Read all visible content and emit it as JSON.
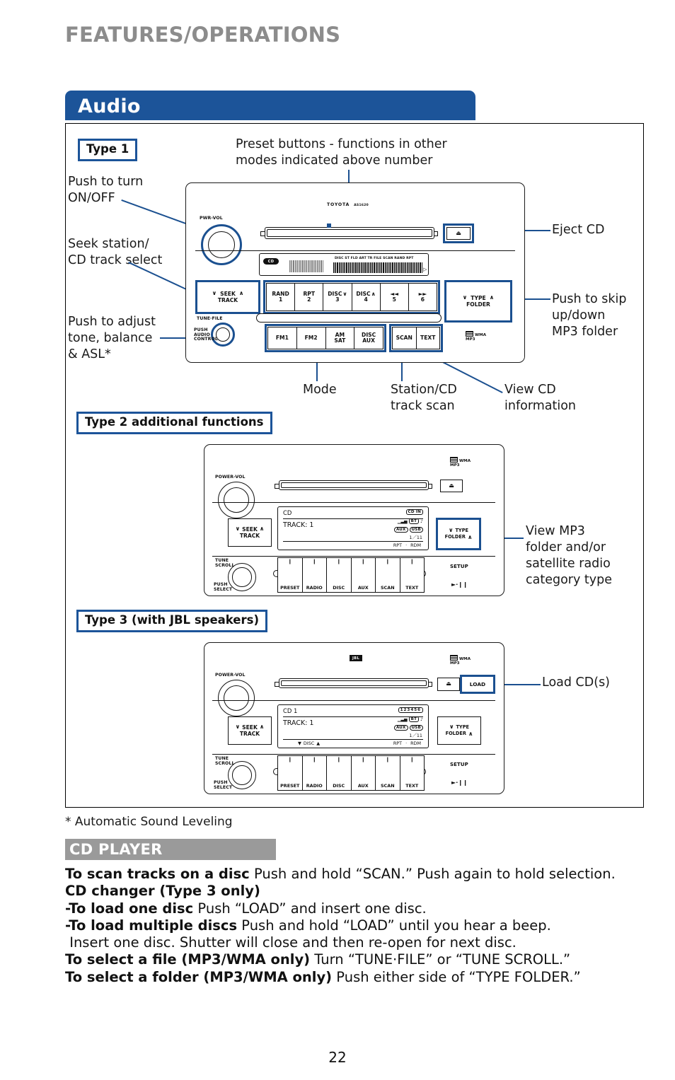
{
  "header": {
    "title": "FEATURES/OPERATIONS"
  },
  "section": {
    "audio_title": "Audio"
  },
  "badges": {
    "type1": "Type 1",
    "type2": "Type 2 additional functions",
    "type3": "Type 3 (with JBL speakers)"
  },
  "callouts": {
    "preset_buttons": "Preset buttons - functions in other\nmodes indicated above number",
    "power_onoff": "Push to turn\nON/OFF",
    "seek_station": "Seek station/\nCD track select",
    "tone_balance": "Push to adjust\ntone, balance\n& ASL*",
    "eject_cd": "Eject CD",
    "skip_folder": "Push to skip\nup/down\nMP3 folder",
    "mode": "Mode",
    "station_scan": "Station/CD\ntrack scan",
    "view_cd_info": "View CD\ninformation",
    "view_mp3_folder": "View MP3\nfolder and/or\nsatellite radio\ncategory type",
    "load_cds": "Load CD(s)"
  },
  "type1_unit": {
    "brand": "TOYOTA",
    "model": "AS1620",
    "pwr_vol_label": "PWR-VOL",
    "tune_file_label": "TUNE·FILE",
    "push_audio_control": "PUSH\nAUDIO\nCONTROL",
    "seek_label_top": "SEEK",
    "seek_label_bottom": "TRACK",
    "type_folder_top": "TYPE",
    "type_folder_bottom": "FOLDER",
    "eject_icon": "eject-icon",
    "wma_mp3": "WMA\nMP3",
    "lcd_indicators": "DISC  ST  FLD  ART  TR  FILE  SCAN  RAND  RPT",
    "lcd_cd_tag": "CD",
    "preset_buttons": [
      {
        "top": "RAND",
        "num": "1"
      },
      {
        "top": "RPT",
        "num": "2"
      },
      {
        "top": "DISC",
        "num": "3",
        "chev": "down"
      },
      {
        "top": "DISC",
        "num": "4",
        "chev": "up"
      },
      {
        "top": "◄◄",
        "num": "5"
      },
      {
        "top": "►►",
        "num": "6"
      }
    ],
    "mode_buttons": [
      {
        "line1": "FM1",
        "line2": ""
      },
      {
        "line1": "FM2",
        "line2": ""
      },
      {
        "line1": "AM",
        "line2": "SAT"
      },
      {
        "line1": "DISC",
        "line2": "AUX"
      }
    ],
    "scan_text_buttons": [
      "SCAN",
      "TEXT"
    ]
  },
  "type2_unit": {
    "power_vol_label": "POWER-VOL",
    "tune_scroll_label": "TUNE\nSCROLL",
    "push_select_label": "PUSH\nSELECT",
    "seek_label_top": "SEEK",
    "seek_label_bottom": "TRACK",
    "type_folder_top": "TYPE",
    "type_folder_bottom": "FOLDER",
    "setup_label": "SETUP",
    "play_pause": "►·❙❙",
    "wma_mp3": "WMA\nMP3",
    "display": {
      "line1": "CD",
      "line2": "TRACK: 1",
      "cd_in": "CD IN",
      "bt": "BT",
      "aux": "AUX",
      "usb": "USB",
      "track_count": "1／11",
      "rpt": "RPT",
      "dot": "·",
      "rdm": "RDM"
    },
    "bottom_buttons": [
      "PRESET",
      "RADIO",
      "DISC",
      "AUX",
      "SCAN",
      "TEXT"
    ]
  },
  "type3_unit": {
    "power_vol_label": "POWER-VOL",
    "tune_scroll_label": "TUNE\nSCROLL",
    "push_select_label": "PUSH\nSELECT",
    "seek_label_top": "SEEK",
    "seek_label_bottom": "TRACK",
    "type_folder_top": "TYPE",
    "type_folder_bottom": "FOLDER",
    "setup_label": "SETUP",
    "load_label": "LOAD",
    "play_pause": "►·❙❙",
    "jbl_badge": "JBL",
    "wma_mp3": "WMA\nMP3",
    "display": {
      "line1": "CD 1",
      "line2": "TRACK: 1",
      "disc_row": "DISC",
      "disc_numbers": "123456",
      "bt": "BT",
      "aux": "AUX",
      "usb": "USB",
      "track_count": "1／11",
      "rpt": "RPT",
      "dot": "·",
      "rdm": "RDM"
    },
    "bottom_buttons": [
      "PRESET",
      "RADIO",
      "DISC",
      "AUX",
      "SCAN",
      "TEXT"
    ]
  },
  "footnote": "* Automatic Sound Leveling",
  "cd_player": {
    "heading": "CD PLAYER",
    "lines": [
      {
        "bold": "To scan tracks on a disc",
        "rest": " Push and hold “SCAN.” Push again to hold selection."
      },
      {
        "bold": "CD changer (Type 3 only)",
        "rest": ""
      },
      {
        "bold": "-To load one disc",
        "rest": " Push “LOAD” and insert one disc."
      },
      {
        "bold": "-To load multiple discs",
        "rest": " Push and hold “LOAD” until you hear a beep."
      },
      {
        "bold": "",
        "rest": " Insert one disc. Shutter will close and then re-open for next disc."
      },
      {
        "bold": "To select a file (MP3/WMA only)",
        "rest": " Turn “TUNE·FILE” or “TUNE SCROLL.”"
      },
      {
        "bold": "To select a folder (MP3/WMA only)",
        "rest": " Push either side of “TYPE FOLDER.”"
      }
    ]
  },
  "page_number": "22",
  "colors": {
    "accent_blue": "#1c5499",
    "lead_blue": "#1b5090",
    "gray_bar": "#9a9a9a",
    "title_gray": "#8c8c8c"
  }
}
